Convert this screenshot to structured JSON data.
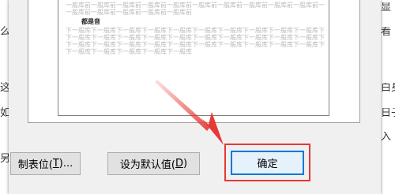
{
  "background": {
    "left_chars": [
      "",
      "么",
      "",
      "这",
      "",
      "如",
      "",
      "另"
    ],
    "right_chars": [
      "显",
      "",
      "看",
      "",
      "白身",
      "日子",
      "入",
      ""
    ]
  },
  "preview": {
    "preceding_lines": [
      "一般库前一般库前一般库前一般库前一般库前一般库前一般库前一般库前一般库前一般库前一般库前一般库前",
      "一般库前一般库前一般库前一般库前一般库前"
    ],
    "current_paragraph": "都是音",
    "following_lines": [
      "下一般库下一般库下一般库下一般库下一般库下一般库下一般库下一般库下一般库下一般库下一般库下一般库",
      "下一般库下一般库下一般库下一般库下一般库下一般库下一般库下一般库下一般库下一般库下一般库下一般库",
      "下一般库下一般库下一般库下一般库下一般库下一般库下一般库下一般库下一般库下一般库下一般库下一般库",
      "下一般库下一般库下一般库下一般库下一般库"
    ]
  },
  "buttons": {
    "tabs_main": "制表位(",
    "tabs_key": "T",
    "tabs_tail": ")...",
    "default_main": "设为默认值(",
    "default_key": "D",
    "default_tail": ")",
    "ok": "确定"
  },
  "colors": {
    "annotation_red": "#e53935",
    "focus_blue": "#0078d7"
  }
}
